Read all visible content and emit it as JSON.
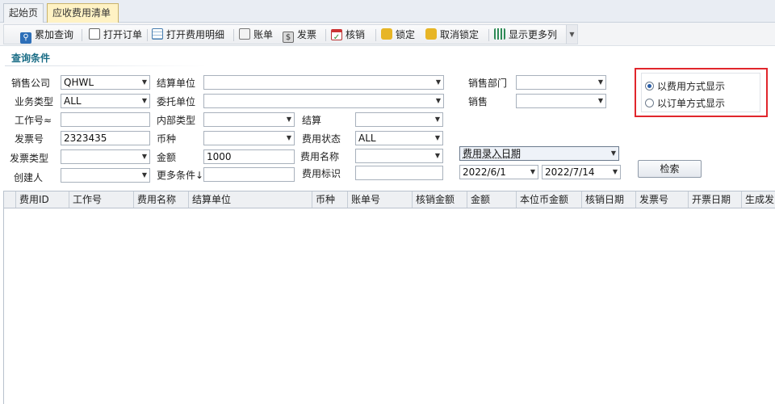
{
  "tabs": [
    {
      "label": "起始页",
      "active": false
    },
    {
      "label": "应收费用清单",
      "active": true
    }
  ],
  "toolbar": {
    "buttons": [
      {
        "label": "累加查询",
        "icon": "magnifier-icon"
      },
      {
        "label": "打开订单",
        "icon": "document-icon"
      },
      {
        "label": "打开费用明细",
        "icon": "table-icon"
      },
      {
        "label": "账单",
        "icon": "bill-icon"
      },
      {
        "label": "发票",
        "icon": "invoice-icon"
      },
      {
        "label": "核销",
        "icon": "calendar-check-icon"
      },
      {
        "label": "锁定",
        "icon": "lock-icon"
      },
      {
        "label": "取消锁定",
        "icon": "unlock-icon"
      },
      {
        "label": "显示更多列",
        "icon": "columns-icon"
      }
    ]
  },
  "query": {
    "section_title": "查询条件",
    "labels": {
      "sales_company": "销售公司",
      "settle_unit": "结算单位",
      "sales_dept": "销售部门",
      "biz_type": "业务类型",
      "consign_unit": "委托单位",
      "sales": "销售",
      "job_no": "工作号≈",
      "internal_type": "内部类型",
      "settle": "结算",
      "invoice_no": "发票号",
      "currency": "币种",
      "fee_status": "费用状态",
      "invoice_type": "发票类型",
      "amount": "金额",
      "fee_name": "费用名称",
      "creator": "创建人",
      "more_conditions": "更多条件↓",
      "fee_flag": "费用标识"
    },
    "values": {
      "sales_company": "QHWL",
      "biz_type": "ALL",
      "invoice_no": "2323435",
      "amount": "1000",
      "fee_status": "ALL",
      "date_type": "费用录入日期",
      "date_from": "2022/6/1",
      "date_to": "2022/7/14"
    },
    "display_mode": {
      "options": [
        "以费用方式显示",
        "以订单方式显示"
      ],
      "selected": 0
    },
    "search_button": "检索"
  },
  "grid": {
    "columns": [
      "费用ID",
      "工作号",
      "费用名称",
      "结算单位",
      "币种",
      "账单号",
      "核销金额",
      "金额",
      "本位币金额",
      "核销日期",
      "发票号",
      "开票日期",
      "生成发"
    ]
  },
  "colors": {
    "accent": "#1a6d86",
    "highlight_border": "#e1262c",
    "active_tab": "#fff2c4"
  }
}
